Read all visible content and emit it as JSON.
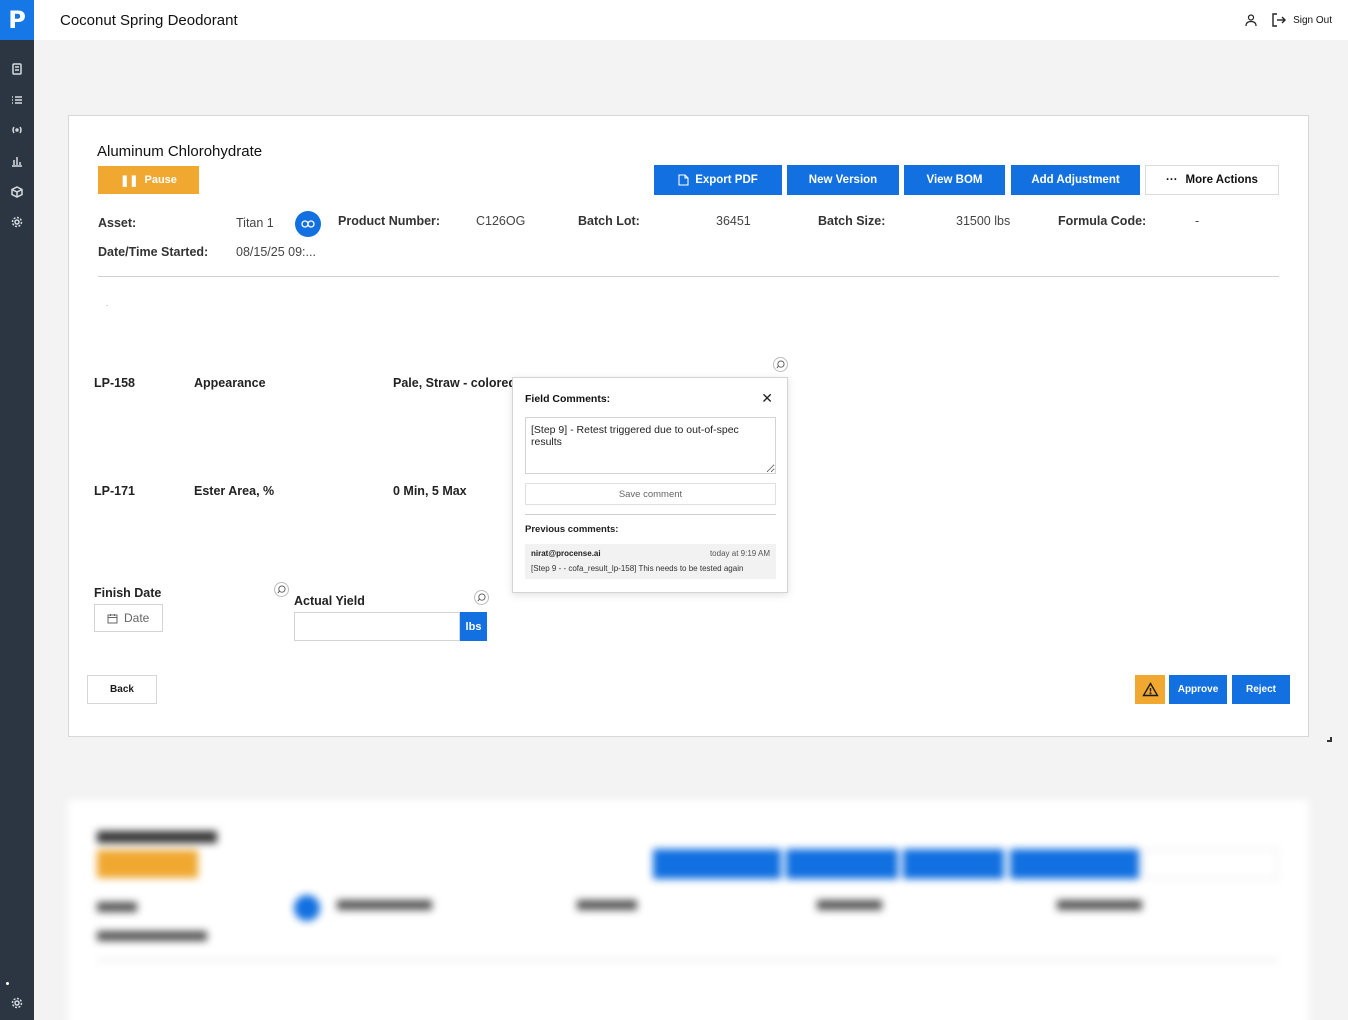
{
  "app": {
    "logo": "P",
    "title": "Coconut Spring Deodorant",
    "signout_label": "Sign Out"
  },
  "colors": {
    "primary": "#1270e0",
    "warning": "#f0a830",
    "sidebar": "#2c3542"
  },
  "sidebar": {
    "items": [
      "calculator-icon",
      "list-icon",
      "broadcast-icon",
      "chart-icon",
      "package-icon",
      "gear-icon"
    ],
    "bottom": "gear-icon"
  },
  "card": {
    "title": "Aluminum Chlorohydrate",
    "pause_label": "Pause",
    "actions": {
      "export_pdf": "Export PDF",
      "new_version": "New Version",
      "view_bom": "View BOM",
      "add_adjustment": "Add Adjustment",
      "more_actions": "More Actions"
    },
    "meta": {
      "asset_label": "Asset:",
      "asset_value": "Titan 1",
      "product_number_label": "Product Number:",
      "product_number_value": "C126OG",
      "batch_lot_label": "Batch Lot:",
      "batch_lot_value": "36451",
      "batch_size_label": "Batch Size:",
      "batch_size_value": "31500 lbs",
      "formula_code_label": "Formula Code:",
      "formula_code_value": "-",
      "date_started_label": "Date/Time Started:",
      "date_started_value": "08/15/25 09:..."
    },
    "rows": [
      {
        "code": "LP-158",
        "name": "Appearance",
        "spec": "Pale, Straw - colored"
      },
      {
        "code": "LP-171",
        "name": "Ester Area, %",
        "spec": "0 Min, 5 Max"
      }
    ],
    "finish_date": {
      "label": "Finish Date",
      "placeholder": "Date"
    },
    "actual_yield": {
      "label": "Actual Yield",
      "value": "",
      "unit": "lbs"
    },
    "back_label": "Back",
    "approve_label": "Approve",
    "reject_label": "Reject"
  },
  "popover": {
    "title": "Field Comments:",
    "comment_text": "[Step 9] - Retest triggered due to out-of-spec results",
    "save_label": "Save comment",
    "previous_label": "Previous comments:",
    "previous": [
      {
        "user": "nirat@procense.ai",
        "time": "today at 9:19 AM",
        "text": "[Step 9 - - cofa_result_lp-158] This needs to be tested again"
      }
    ]
  }
}
